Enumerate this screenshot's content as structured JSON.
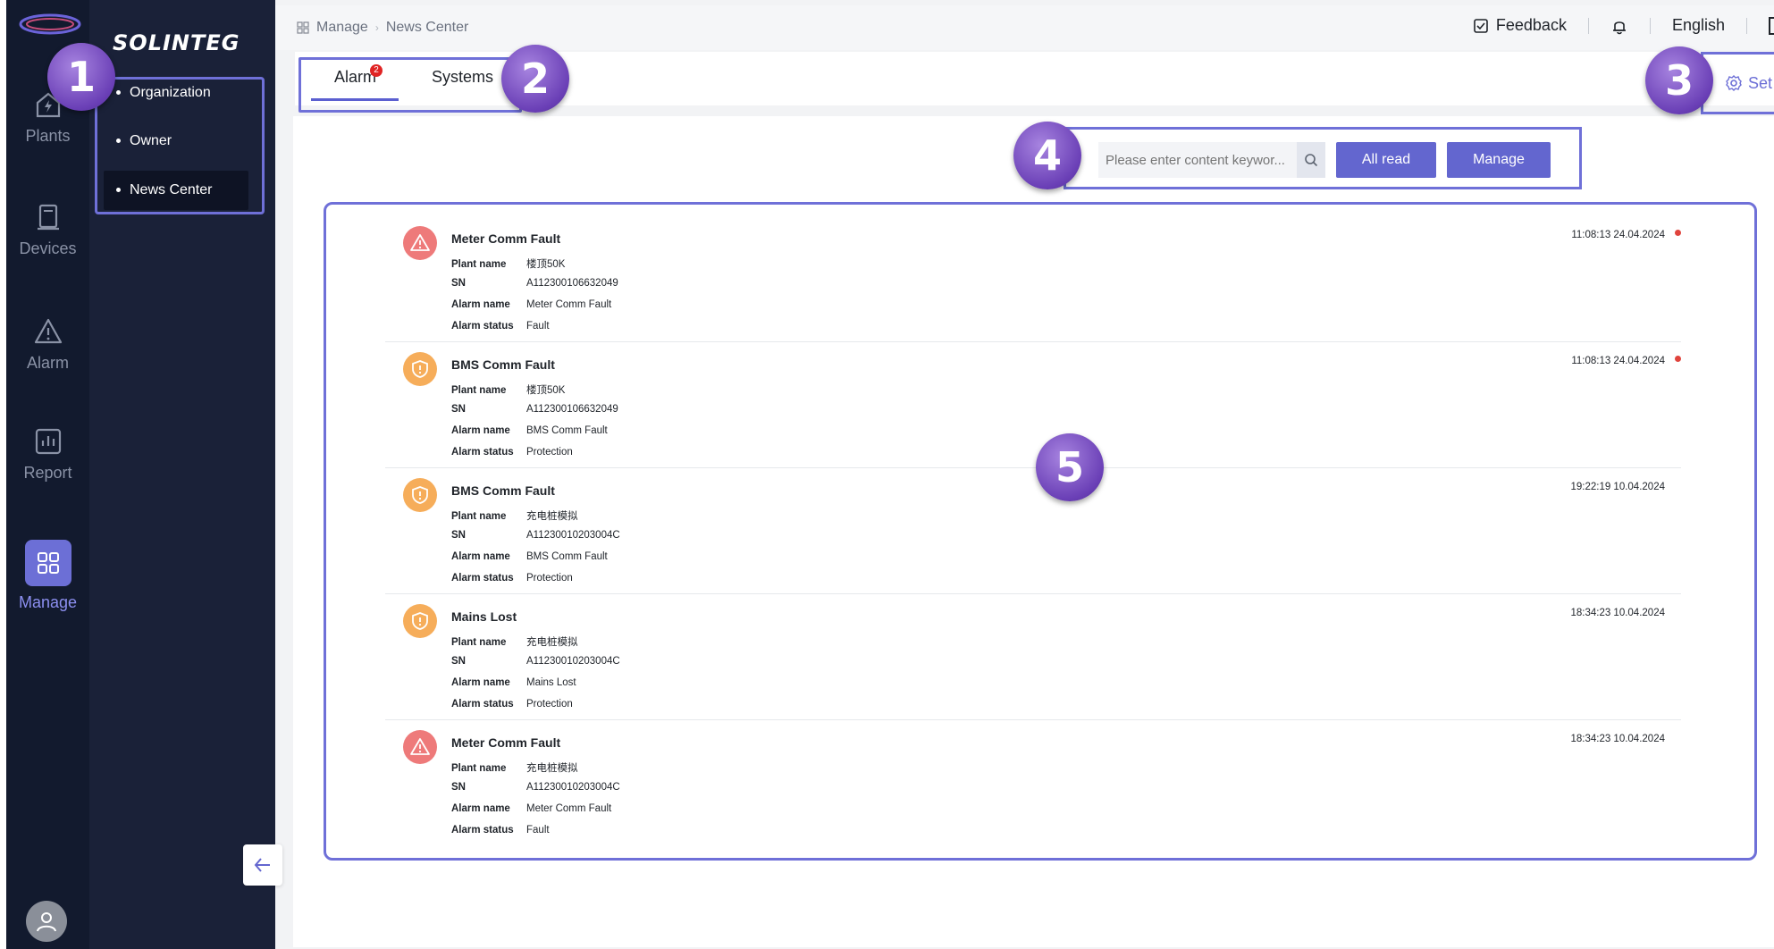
{
  "brand": "SOLINTEG",
  "rail": {
    "items": [
      {
        "label": "Plants",
        "icon": "plant-icon"
      },
      {
        "label": "Devices",
        "icon": "device-icon"
      },
      {
        "label": "Alarm",
        "icon": "alarm-icon"
      },
      {
        "label": "Report",
        "icon": "report-icon"
      },
      {
        "label": "Manage",
        "icon": "manage-icon"
      }
    ]
  },
  "subnav": {
    "items": [
      {
        "label": "Organization"
      },
      {
        "label": "Owner"
      },
      {
        "label": "News Center"
      }
    ],
    "active": "News Center"
  },
  "breadcrumb": {
    "root": "Manage",
    "current": "News Center"
  },
  "topbar": {
    "feedback": "Feedback",
    "language": "English"
  },
  "tabs": [
    {
      "label": "Alarm",
      "badge": "2"
    },
    {
      "label": "Systems"
    }
  ],
  "settings_label": "Set",
  "search": {
    "placeholder": "Please enter content keywor..."
  },
  "buttons": {
    "all_read": "All read",
    "manage": "Manage"
  },
  "field_labels": {
    "plant": "Plant name",
    "sn": "SN",
    "alarm_name": "Alarm name",
    "alarm_status": "Alarm status"
  },
  "messages": [
    {
      "title": "Meter Comm Fault",
      "plant": "楼顶50K",
      "sn": "A112300106632049",
      "alarm_name": "Meter Comm Fault",
      "status": "Fault",
      "time": "11:08:13 24.04.2024",
      "unread": true,
      "level": "fault"
    },
    {
      "title": "BMS Comm Fault",
      "plant": "楼顶50K",
      "sn": "A112300106632049",
      "alarm_name": "BMS Comm Fault",
      "status": "Protection",
      "time": "11:08:13 24.04.2024",
      "unread": true,
      "level": "protection"
    },
    {
      "title": "BMS Comm Fault",
      "plant": "充电桩模拟",
      "sn": "A11230010203004C",
      "alarm_name": "BMS Comm Fault",
      "status": "Protection",
      "time": "19:22:19 10.04.2024",
      "unread": false,
      "level": "protection"
    },
    {
      "title": "Mains Lost",
      "plant": "充电桩模拟",
      "sn": "A11230010203004C",
      "alarm_name": "Mains Lost",
      "status": "Protection",
      "time": "18:34:23 10.04.2024",
      "unread": false,
      "level": "protection"
    },
    {
      "title": "Meter Comm Fault",
      "plant": "充电桩模拟",
      "sn": "A11230010203004C",
      "alarm_name": "Meter Comm Fault",
      "status": "Fault",
      "time": "18:34:23 10.04.2024",
      "unread": false,
      "level": "fault"
    }
  ],
  "markers": [
    "1",
    "2",
    "3",
    "4",
    "5"
  ],
  "colors": {
    "accent": "#6366cf",
    "rail_bg": "#121a2e",
    "sidebar_bg": "#1a2138",
    "fault": "#ee7a7a",
    "protection": "#f6ad5a",
    "unread": "#e0443d",
    "annotation": "#6f70d8"
  }
}
